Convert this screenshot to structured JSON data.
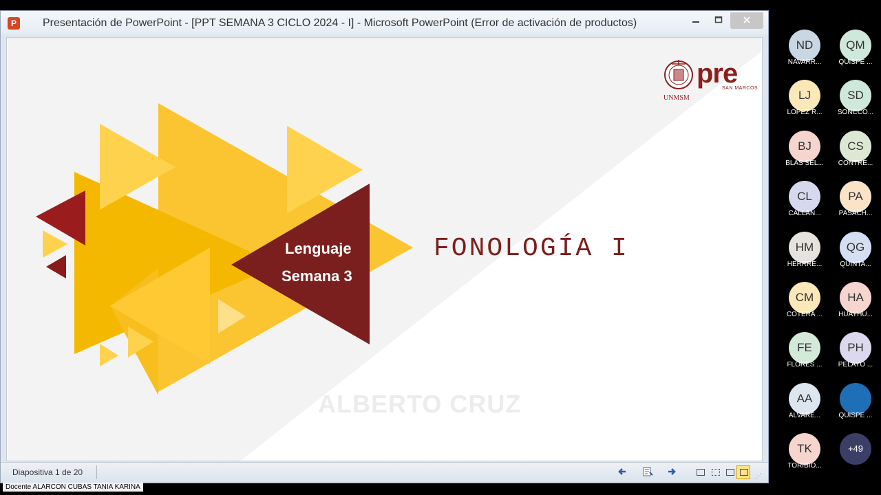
{
  "window": {
    "title": "Presentación de PowerPoint - [PPT SEMANA 3 CICLO 2024 - I] - Microsoft PowerPoint (Error de activación de productos)",
    "app_icon": "P",
    "minimize_icon": "minimize-icon",
    "maximize_icon": "maximize-icon",
    "close_icon": "close-icon"
  },
  "slide": {
    "course_line1": "Lenguaje",
    "course_line2": "Semana 3",
    "title": "FONOLOGÍA I",
    "author": "ALBERTO CRUZ",
    "logo": {
      "pre": "pre",
      "san_marcos": "SAN MARCOS",
      "unmsm": "UNMSM"
    },
    "colors": {
      "maroon": "#7b1e1e",
      "gold": "#f5b800",
      "light_gold": "#ffd24d",
      "dark_gold": "#e3a000"
    }
  },
  "statusbar": {
    "slide_counter": "Diapositiva 1 de 20",
    "view_buttons": [
      "normal-view-icon",
      "slide-sorter-icon",
      "reading-view-icon",
      "slideshow-icon"
    ]
  },
  "presenter_label": "Docente ALARCON CUBAS TANIA KARINA",
  "participants": [
    {
      "initials": "ND",
      "name": "NAVARR...",
      "color": "#c9d6e3"
    },
    {
      "initials": "QM",
      "name": "QUISPE ...",
      "color": "#cfe8dc"
    },
    {
      "initials": "LJ",
      "name": "LOPEZ R...",
      "color": "#fbe8b8"
    },
    {
      "initials": "SD",
      "name": "SONCCO...",
      "color": "#cfe8dc"
    },
    {
      "initials": "BJ",
      "name": "BLAS SEL...",
      "color": "#f6d5cf"
    },
    {
      "initials": "CS",
      "name": "CONTRE...",
      "color": "#dde8d4"
    },
    {
      "initials": "CL",
      "name": "CALLAN...",
      "color": "#d6d9ee"
    },
    {
      "initials": "PA",
      "name": "PASACH...",
      "color": "#fbe3c8"
    },
    {
      "initials": "HM",
      "name": "HERRRE...",
      "color": "#e6e2dd"
    },
    {
      "initials": "QG",
      "name": "QUINTA...",
      "color": "#d5dff2"
    },
    {
      "initials": "CM",
      "name": "COTERA ...",
      "color": "#fbe8b8"
    },
    {
      "initials": "HA",
      "name": "HUAYHU...",
      "color": "#f6d5cf"
    },
    {
      "initials": "FE",
      "name": "FLORES ...",
      "color": "#d4ead8"
    },
    {
      "initials": "PH",
      "name": "PELAYO ...",
      "color": "#dcd9ee"
    },
    {
      "initials": "AA",
      "name": "ALVARE...",
      "color": "#dde5ee"
    },
    {
      "initials": "",
      "name": "QUISPE ...",
      "color": "#1e6fb6"
    },
    {
      "initials": "TK",
      "name": "TORIBIO...",
      "color": "#f6d5cf"
    },
    {
      "initials": "+49",
      "name": "",
      "color": "#3b3f66"
    }
  ]
}
